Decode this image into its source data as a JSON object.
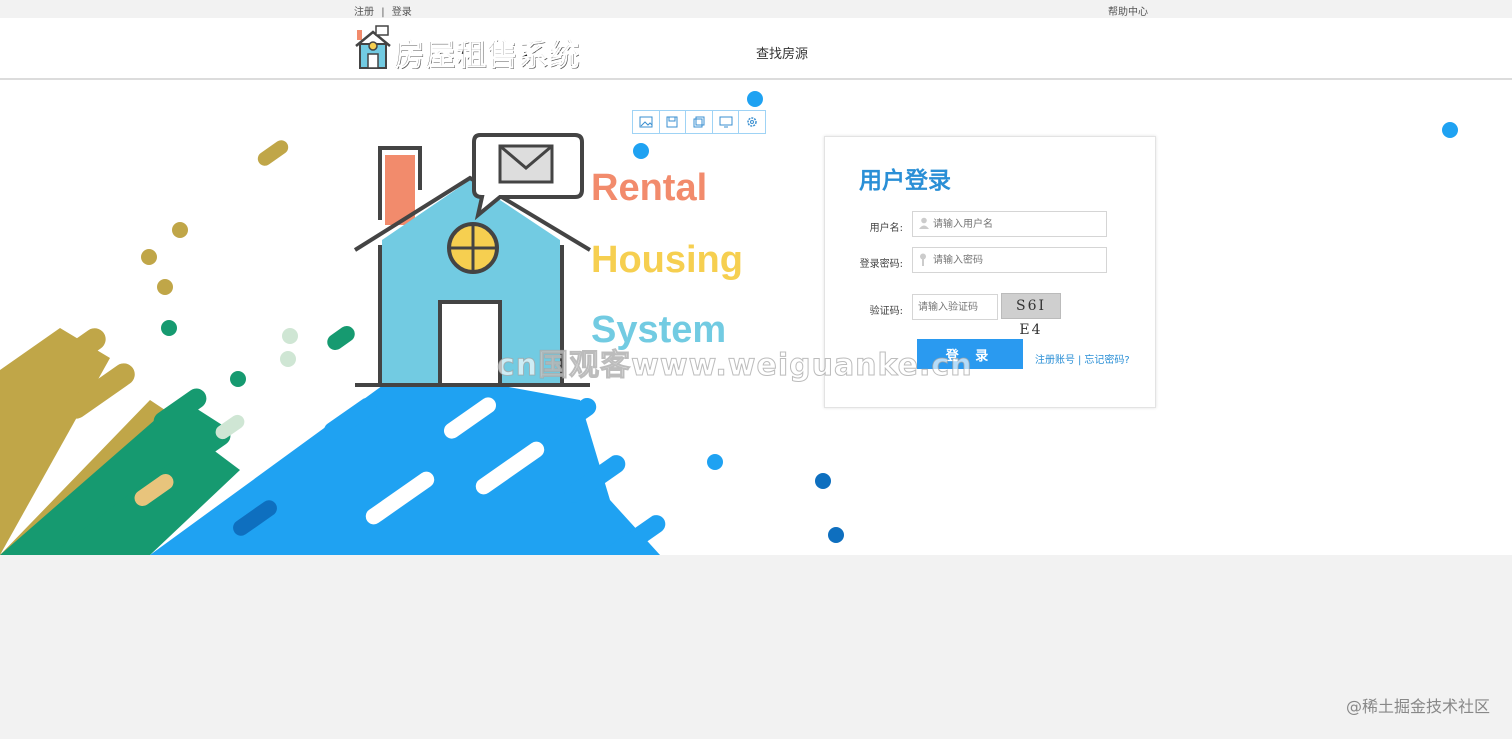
{
  "topbar": {
    "register": "注册",
    "separator": "|",
    "login": "登录",
    "help": "帮助中心"
  },
  "header": {
    "title": "房屋租售系统",
    "nav_find": "查找房源"
  },
  "hero": {
    "word1": "Rental",
    "word2": "Housing",
    "word3": "System",
    "colors": {
      "rental": "#f28b6c",
      "housing": "#f6cf50",
      "system": "#72cbe2",
      "blue": "#1fa2f2",
      "green": "#169a70",
      "olive": "#c0a648"
    }
  },
  "toolbar": {
    "icons": [
      "image-icon",
      "save-icon",
      "copy-icon",
      "monitor-icon",
      "gear-icon"
    ]
  },
  "login": {
    "title": "用户登录",
    "username_label": "用户名:",
    "username_placeholder": "请输入用户名",
    "password_label": "登录密码:",
    "password_placeholder": "请输入密码",
    "captcha_label": "验证码:",
    "captcha_placeholder": "请输入验证码",
    "captcha_text": "S6I E4",
    "button": "登 录",
    "register_link": "注册账号",
    "link_separator": "|",
    "forgot_link": "忘记密码?"
  },
  "watermarks": {
    "center": "cn国观客www.weiguanke.cn",
    "corner": "@稀土掘金技术社区"
  }
}
